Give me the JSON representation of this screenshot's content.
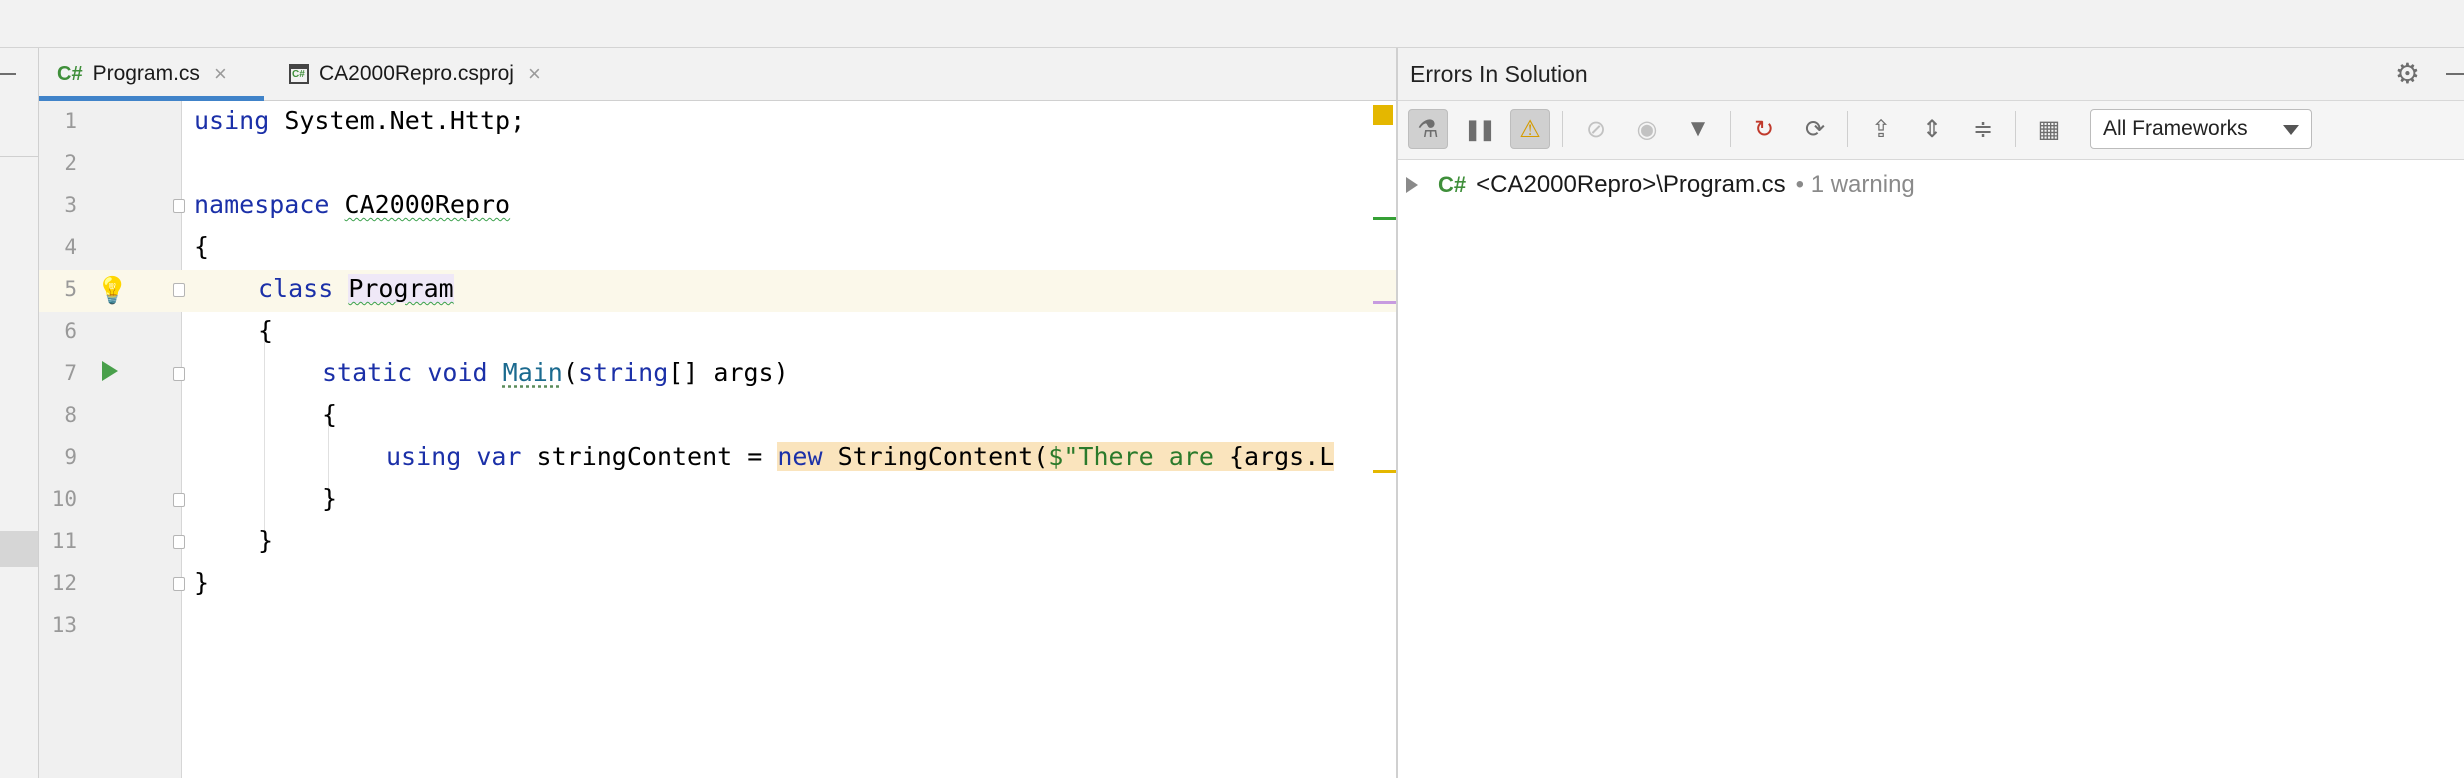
{
  "tabs": [
    {
      "icon": "C#",
      "label": "Program.cs",
      "close": "×"
    },
    {
      "icon": "C#",
      "label": "CA2000Repro.csproj",
      "close": "×"
    }
  ],
  "editor": {
    "line_numbers": [
      "1",
      "2",
      "3",
      "4",
      "5",
      "6",
      "7",
      "8",
      "9",
      "10",
      "11",
      "12",
      "13"
    ],
    "lines": {
      "l1_kw": "using",
      "l1_rest": " System.Net.Http;",
      "l3_kw": "namespace",
      "l3_sp": " ",
      "l3_name": "CA2000Repro",
      "l4": "{",
      "l5_kw": "class",
      "l5_sp": " ",
      "l5_name": "Program",
      "l6": "{",
      "l7_kw1": "static",
      "l7_sp1": " ",
      "l7_kw2": "void",
      "l7_sp2": " ",
      "l7_meth": "Main",
      "l7_p1": "(",
      "l7_kw3": "string",
      "l7_p2": "[] args)",
      "l8": "{",
      "l9_kw1": "using",
      "l9_sp1": " ",
      "l9_kw2": "var",
      "l9_mid": " stringContent = ",
      "l9_new": "new",
      "l9_type": " StringContent(",
      "l9_dollar": "$",
      "l9_str": "\"There are ",
      "l9_interp": "{args.L",
      "l10": "}",
      "l11": "}",
      "l12": "}"
    }
  },
  "panel": {
    "title": "Errors In Solution",
    "framework_select": "All Frameworks",
    "tree": {
      "icon": "C#",
      "path": "<CA2000Repro>\\Program.cs",
      "count": "• 1 warning"
    }
  },
  "colors": {
    "accent_tab": "#4083c9",
    "keyword": "#1b30a8",
    "string": "#2b7a2b",
    "warning_highlight": "#fae4bd",
    "csharp_icon": "#3f8f3a"
  }
}
